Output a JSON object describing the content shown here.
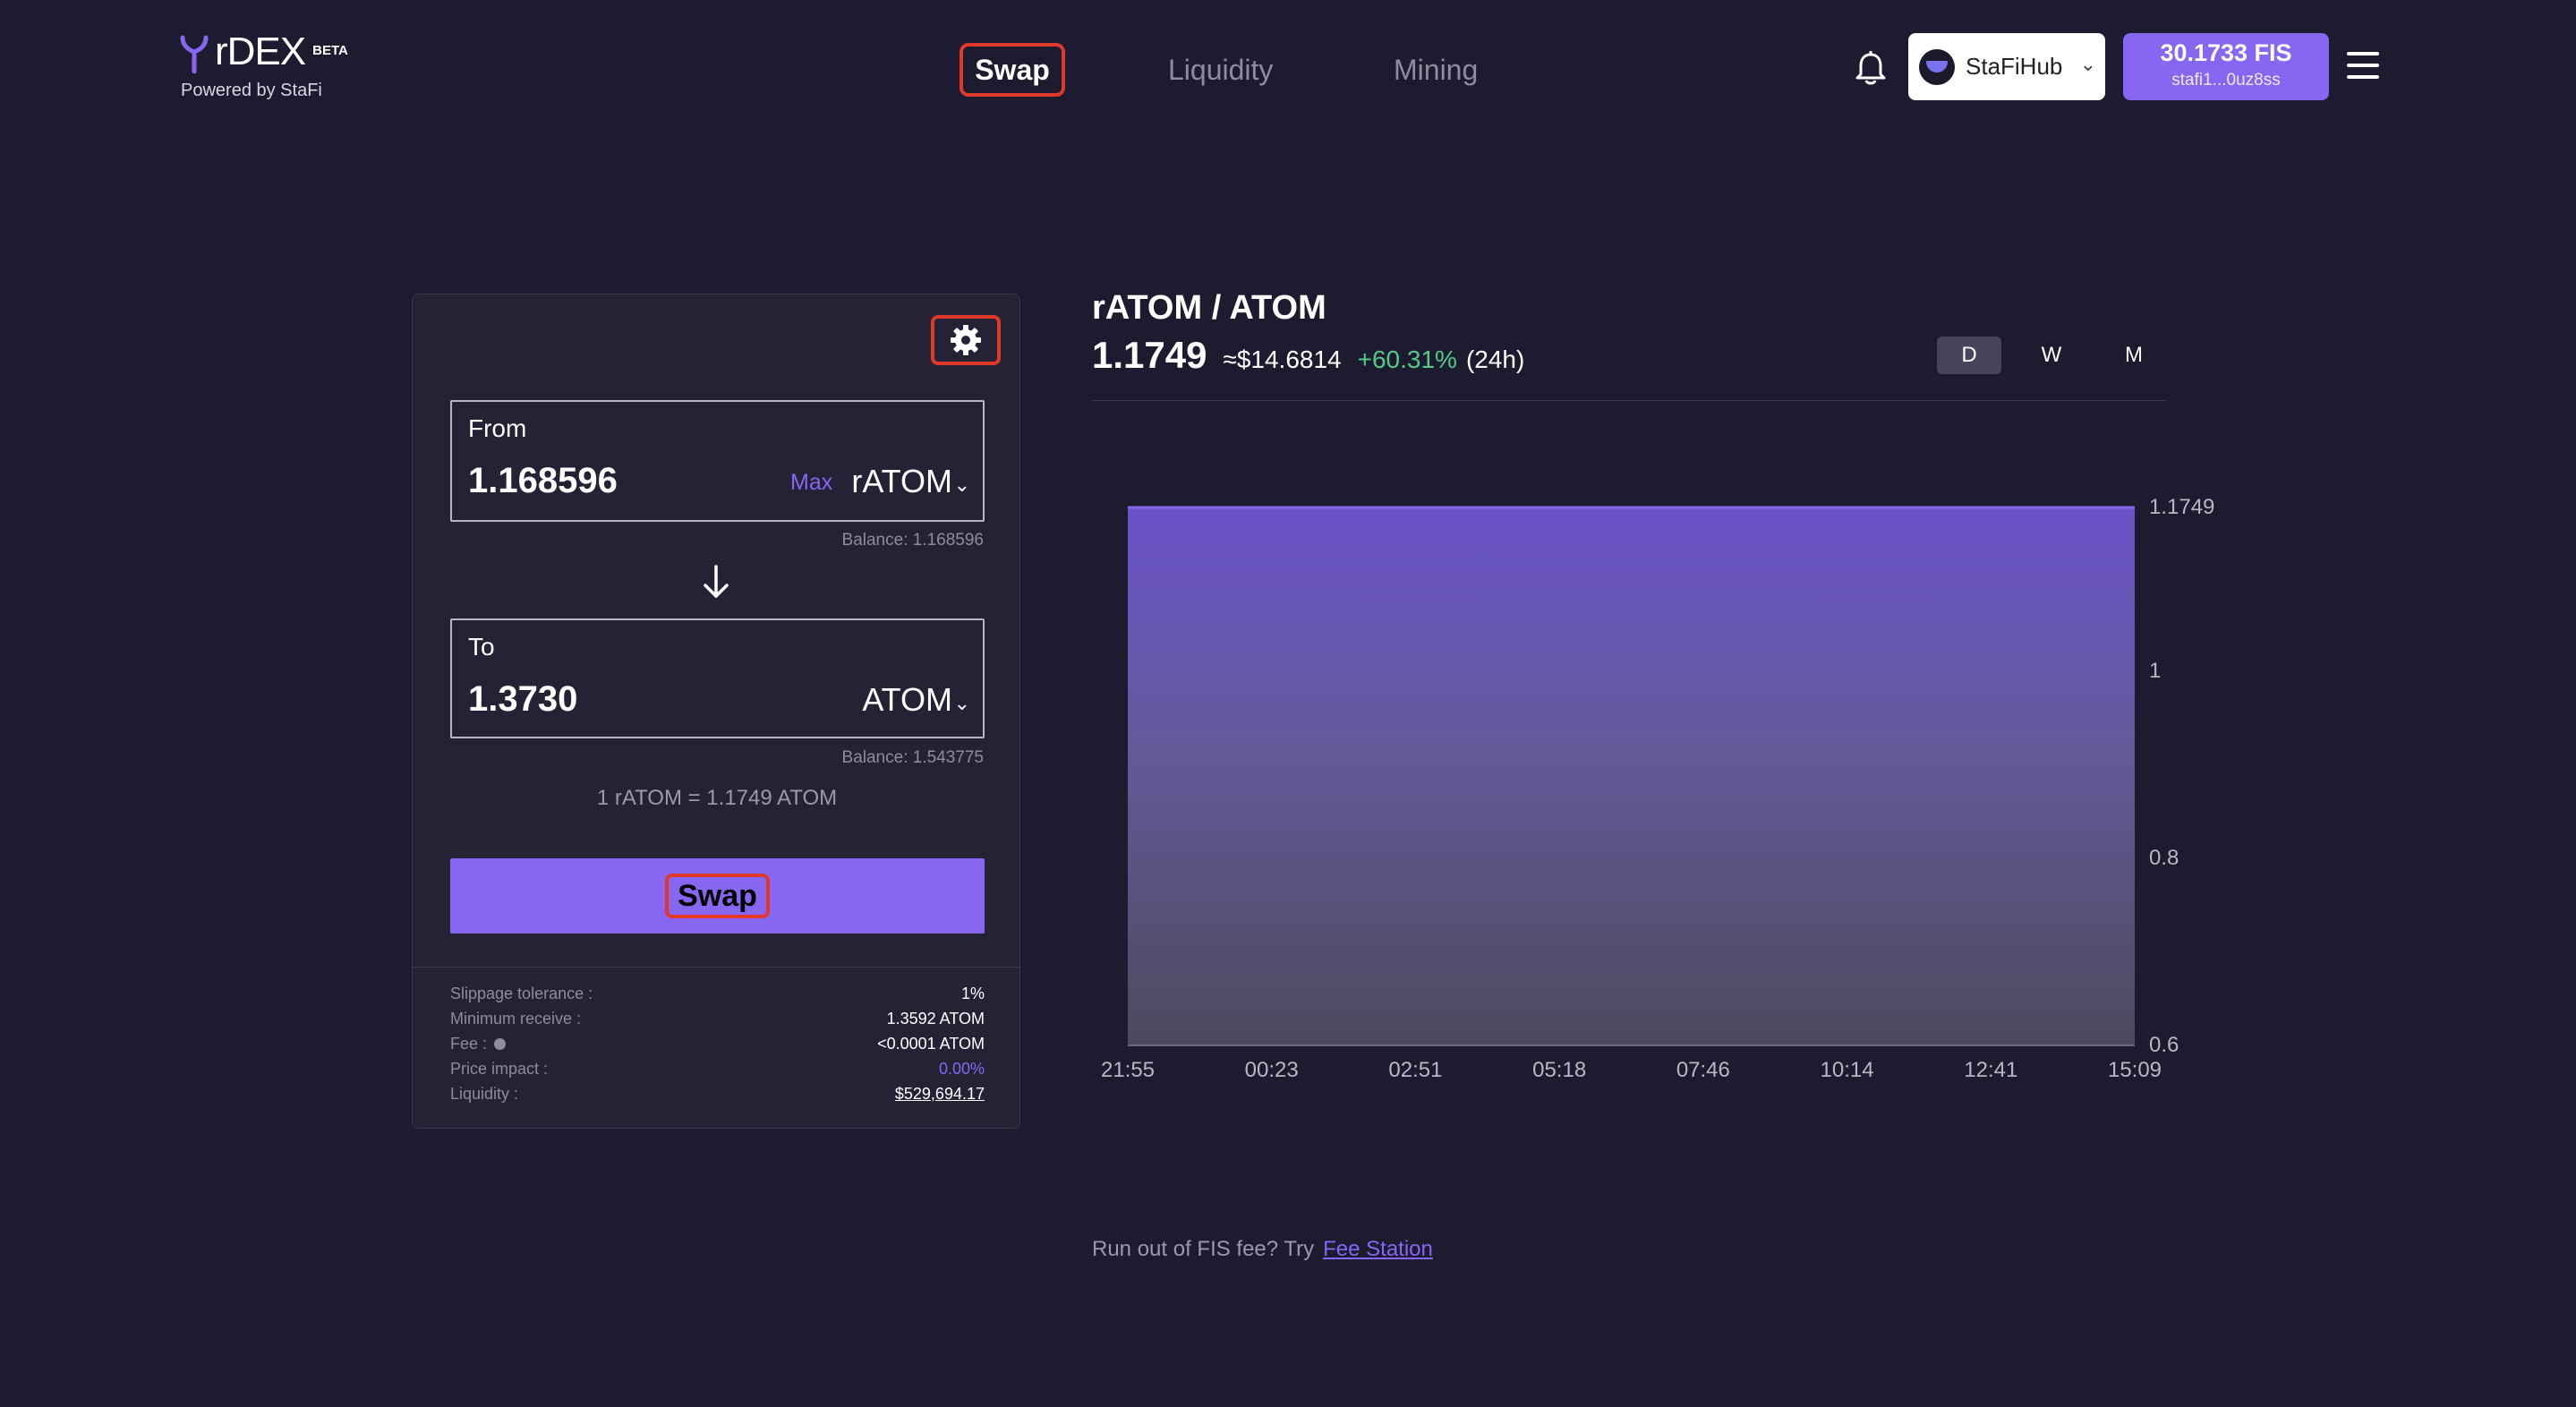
{
  "brand": {
    "name": "rDEX",
    "badge": "BETA",
    "powered_by": "Powered by StaFi"
  },
  "nav": {
    "swap": "Swap",
    "liquidity": "Liquidity",
    "mining": "Mining",
    "active": "Swap"
  },
  "header": {
    "network": "StaFiHub",
    "balance": "30.1733 FIS",
    "address": "stafi1...0uz8ss"
  },
  "swap": {
    "from_label": "From",
    "from_value": "1.168596",
    "max_label": "Max",
    "from_token": "rATOM",
    "from_balance": "Balance: 1.168596",
    "to_label": "To",
    "to_value": "1.3730",
    "to_token": "ATOM",
    "to_balance": "Balance: 1.543775",
    "rate": "1 rATOM = 1.1749 ATOM",
    "button": "Swap"
  },
  "details": {
    "slippage_label": "Slippage tolerance :",
    "slippage_value": "1%",
    "min_receive_label": "Minimum receive :",
    "min_receive_value": "1.3592 ATOM",
    "fee_label": "Fee :",
    "fee_value": "<0.0001 ATOM",
    "impact_label": "Price impact :",
    "impact_value": "0.00%",
    "liquidity_label": "Liquidity :",
    "liquidity_value": "$529,694.17"
  },
  "market": {
    "pair": "rATOM / ATOM",
    "price": "1.1749",
    "usd": "≈$14.6814",
    "change": "+60.31%",
    "period": "(24h)",
    "ranges": [
      "D",
      "W",
      "M"
    ],
    "active_range": "D"
  },
  "chart_data": {
    "type": "area",
    "x": [
      "21:55",
      "00:23",
      "02:51",
      "05:18",
      "07:46",
      "10:14",
      "12:41",
      "15:09"
    ],
    "values": [
      1.1749,
      1.1749,
      1.1749,
      1.1749,
      1.1749,
      1.1749,
      1.1749,
      1.1749
    ],
    "y_ticks": [
      {
        "value": 1.1749,
        "label": "1.1749"
      },
      {
        "value": 1.0,
        "label": "1"
      },
      {
        "value": 0.8,
        "label": "0.8"
      },
      {
        "value": 0.6,
        "label": "0.6"
      }
    ],
    "ylim": [
      0.6,
      1.1749
    ],
    "grid": false,
    "color": "#8766f2"
  },
  "footer": {
    "text": "Run out of FIS fee? Try",
    "link": "Fee Station"
  },
  "colors": {
    "background": "#1d1b2f",
    "accent": "#8766f2",
    "positive": "#55c98a",
    "highlight": "#e0392b"
  }
}
